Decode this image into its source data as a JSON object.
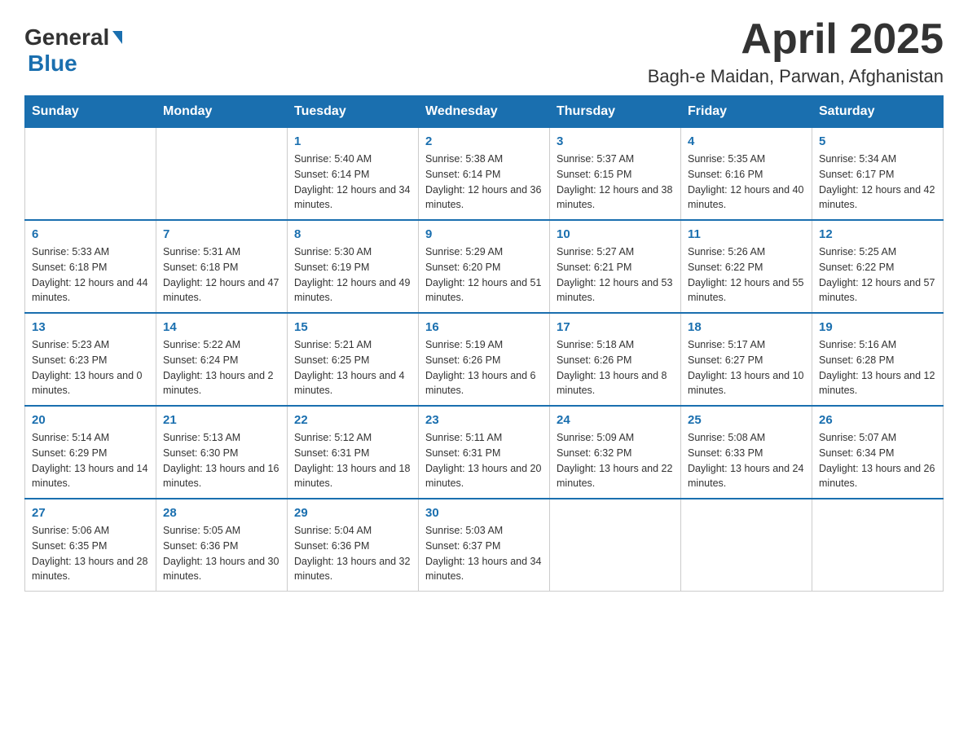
{
  "header": {
    "logo_general": "General",
    "logo_blue": "Blue",
    "month": "April 2025",
    "location": "Bagh-e Maidan, Parwan, Afghanistan"
  },
  "weekdays": [
    "Sunday",
    "Monday",
    "Tuesday",
    "Wednesday",
    "Thursday",
    "Friday",
    "Saturday"
  ],
  "weeks": [
    [
      {
        "day": "",
        "sunrise": "",
        "sunset": "",
        "daylight": ""
      },
      {
        "day": "",
        "sunrise": "",
        "sunset": "",
        "daylight": ""
      },
      {
        "day": "1",
        "sunrise": "Sunrise: 5:40 AM",
        "sunset": "Sunset: 6:14 PM",
        "daylight": "Daylight: 12 hours and 34 minutes."
      },
      {
        "day": "2",
        "sunrise": "Sunrise: 5:38 AM",
        "sunset": "Sunset: 6:14 PM",
        "daylight": "Daylight: 12 hours and 36 minutes."
      },
      {
        "day": "3",
        "sunrise": "Sunrise: 5:37 AM",
        "sunset": "Sunset: 6:15 PM",
        "daylight": "Daylight: 12 hours and 38 minutes."
      },
      {
        "day": "4",
        "sunrise": "Sunrise: 5:35 AM",
        "sunset": "Sunset: 6:16 PM",
        "daylight": "Daylight: 12 hours and 40 minutes."
      },
      {
        "day": "5",
        "sunrise": "Sunrise: 5:34 AM",
        "sunset": "Sunset: 6:17 PM",
        "daylight": "Daylight: 12 hours and 42 minutes."
      }
    ],
    [
      {
        "day": "6",
        "sunrise": "Sunrise: 5:33 AM",
        "sunset": "Sunset: 6:18 PM",
        "daylight": "Daylight: 12 hours and 44 minutes."
      },
      {
        "day": "7",
        "sunrise": "Sunrise: 5:31 AM",
        "sunset": "Sunset: 6:18 PM",
        "daylight": "Daylight: 12 hours and 47 minutes."
      },
      {
        "day": "8",
        "sunrise": "Sunrise: 5:30 AM",
        "sunset": "Sunset: 6:19 PM",
        "daylight": "Daylight: 12 hours and 49 minutes."
      },
      {
        "day": "9",
        "sunrise": "Sunrise: 5:29 AM",
        "sunset": "Sunset: 6:20 PM",
        "daylight": "Daylight: 12 hours and 51 minutes."
      },
      {
        "day": "10",
        "sunrise": "Sunrise: 5:27 AM",
        "sunset": "Sunset: 6:21 PM",
        "daylight": "Daylight: 12 hours and 53 minutes."
      },
      {
        "day": "11",
        "sunrise": "Sunrise: 5:26 AM",
        "sunset": "Sunset: 6:22 PM",
        "daylight": "Daylight: 12 hours and 55 minutes."
      },
      {
        "day": "12",
        "sunrise": "Sunrise: 5:25 AM",
        "sunset": "Sunset: 6:22 PM",
        "daylight": "Daylight: 12 hours and 57 minutes."
      }
    ],
    [
      {
        "day": "13",
        "sunrise": "Sunrise: 5:23 AM",
        "sunset": "Sunset: 6:23 PM",
        "daylight": "Daylight: 13 hours and 0 minutes."
      },
      {
        "day": "14",
        "sunrise": "Sunrise: 5:22 AM",
        "sunset": "Sunset: 6:24 PM",
        "daylight": "Daylight: 13 hours and 2 minutes."
      },
      {
        "day": "15",
        "sunrise": "Sunrise: 5:21 AM",
        "sunset": "Sunset: 6:25 PM",
        "daylight": "Daylight: 13 hours and 4 minutes."
      },
      {
        "day": "16",
        "sunrise": "Sunrise: 5:19 AM",
        "sunset": "Sunset: 6:26 PM",
        "daylight": "Daylight: 13 hours and 6 minutes."
      },
      {
        "day": "17",
        "sunrise": "Sunrise: 5:18 AM",
        "sunset": "Sunset: 6:26 PM",
        "daylight": "Daylight: 13 hours and 8 minutes."
      },
      {
        "day": "18",
        "sunrise": "Sunrise: 5:17 AM",
        "sunset": "Sunset: 6:27 PM",
        "daylight": "Daylight: 13 hours and 10 minutes."
      },
      {
        "day": "19",
        "sunrise": "Sunrise: 5:16 AM",
        "sunset": "Sunset: 6:28 PM",
        "daylight": "Daylight: 13 hours and 12 minutes."
      }
    ],
    [
      {
        "day": "20",
        "sunrise": "Sunrise: 5:14 AM",
        "sunset": "Sunset: 6:29 PM",
        "daylight": "Daylight: 13 hours and 14 minutes."
      },
      {
        "day": "21",
        "sunrise": "Sunrise: 5:13 AM",
        "sunset": "Sunset: 6:30 PM",
        "daylight": "Daylight: 13 hours and 16 minutes."
      },
      {
        "day": "22",
        "sunrise": "Sunrise: 5:12 AM",
        "sunset": "Sunset: 6:31 PM",
        "daylight": "Daylight: 13 hours and 18 minutes."
      },
      {
        "day": "23",
        "sunrise": "Sunrise: 5:11 AM",
        "sunset": "Sunset: 6:31 PM",
        "daylight": "Daylight: 13 hours and 20 minutes."
      },
      {
        "day": "24",
        "sunrise": "Sunrise: 5:09 AM",
        "sunset": "Sunset: 6:32 PM",
        "daylight": "Daylight: 13 hours and 22 minutes."
      },
      {
        "day": "25",
        "sunrise": "Sunrise: 5:08 AM",
        "sunset": "Sunset: 6:33 PM",
        "daylight": "Daylight: 13 hours and 24 minutes."
      },
      {
        "day": "26",
        "sunrise": "Sunrise: 5:07 AM",
        "sunset": "Sunset: 6:34 PM",
        "daylight": "Daylight: 13 hours and 26 minutes."
      }
    ],
    [
      {
        "day": "27",
        "sunrise": "Sunrise: 5:06 AM",
        "sunset": "Sunset: 6:35 PM",
        "daylight": "Daylight: 13 hours and 28 minutes."
      },
      {
        "day": "28",
        "sunrise": "Sunrise: 5:05 AM",
        "sunset": "Sunset: 6:36 PM",
        "daylight": "Daylight: 13 hours and 30 minutes."
      },
      {
        "day": "29",
        "sunrise": "Sunrise: 5:04 AM",
        "sunset": "Sunset: 6:36 PM",
        "daylight": "Daylight: 13 hours and 32 minutes."
      },
      {
        "day": "30",
        "sunrise": "Sunrise: 5:03 AM",
        "sunset": "Sunset: 6:37 PM",
        "daylight": "Daylight: 13 hours and 34 minutes."
      },
      {
        "day": "",
        "sunrise": "",
        "sunset": "",
        "daylight": ""
      },
      {
        "day": "",
        "sunrise": "",
        "sunset": "",
        "daylight": ""
      },
      {
        "day": "",
        "sunrise": "",
        "sunset": "",
        "daylight": ""
      }
    ]
  ]
}
